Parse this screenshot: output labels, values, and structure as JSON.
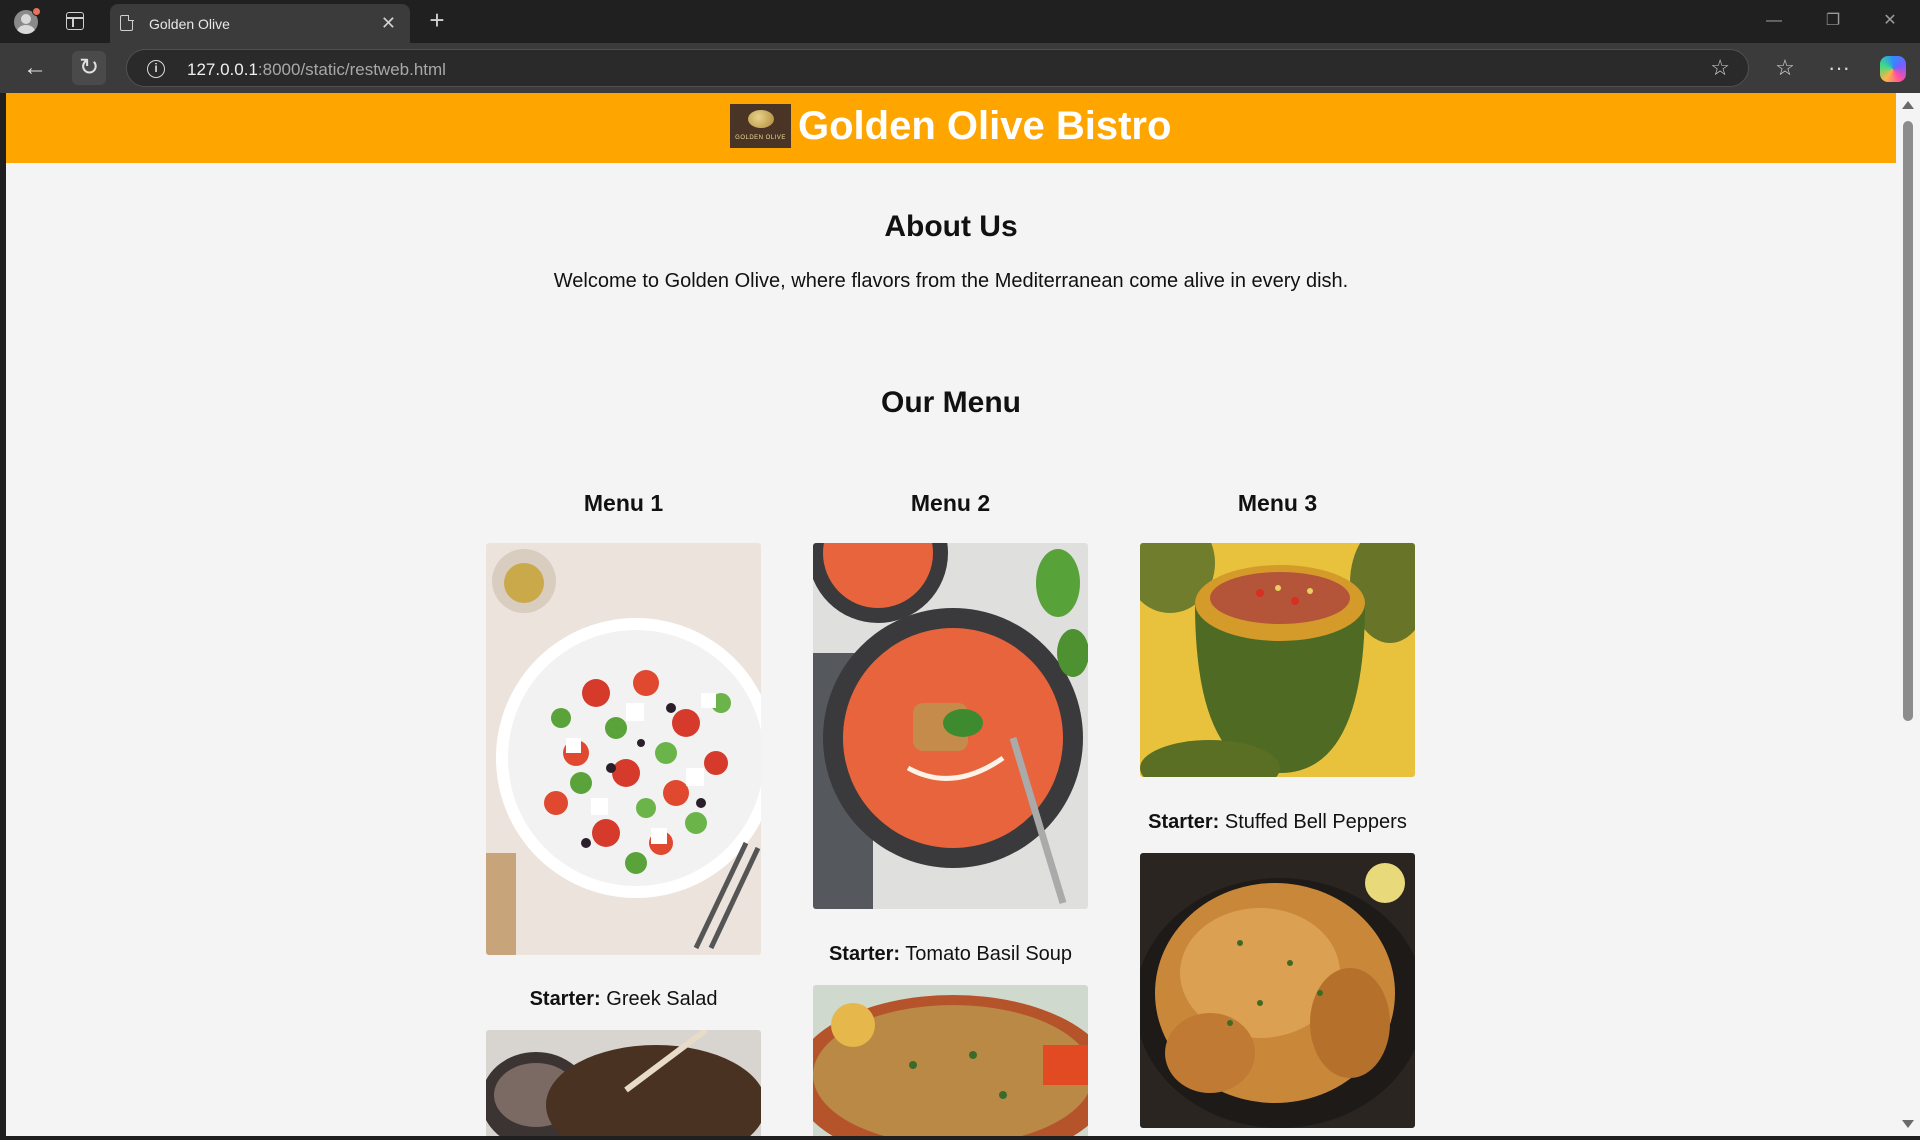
{
  "browser": {
    "tab_title": "Golden Olive",
    "tab_close": "✕",
    "new_tab": "+",
    "url_host": "127.0.0.1",
    "url_path": ":8000/static/restweb.html",
    "window_controls": {
      "minimize": "—",
      "restore": "❐",
      "close": "✕"
    },
    "icons": {
      "back": "←",
      "reload": "↻",
      "info": "i",
      "star": "☆",
      "favorites": "☆",
      "more": "···"
    }
  },
  "site": {
    "name": "Golden Olive Bistro",
    "logo_text": "GOLDEN OLIVE",
    "brand_color": "#ffa500"
  },
  "about": {
    "title": "About Us",
    "text": "Welcome to Golden Olive, where flavors from the Mediterranean come alive in every dish."
  },
  "menu": {
    "title": "Our Menu",
    "columns": [
      {
        "title": "Menu 1",
        "starter_label": "Starter:",
        "starter": "Greek Salad"
      },
      {
        "title": "Menu 2",
        "starter_label": "Starter:",
        "starter": "Tomato Basil Soup"
      },
      {
        "title": "Menu 3",
        "starter_label": "Starter:",
        "starter": "Stuffed Bell Peppers"
      }
    ]
  }
}
